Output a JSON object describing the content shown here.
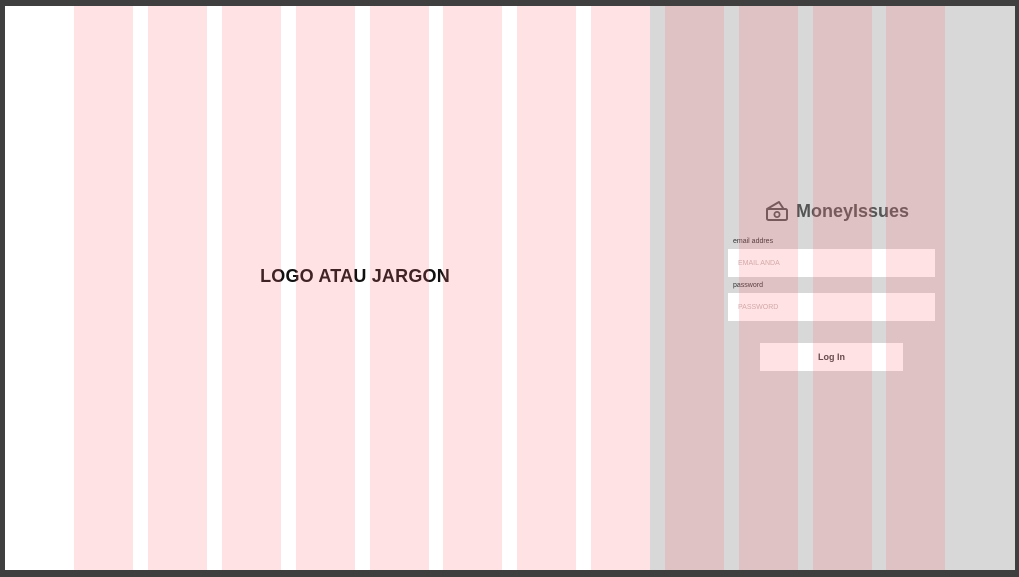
{
  "left_panel": {
    "tagline": "LOGO ATAU JARGON"
  },
  "brand": {
    "name": "MoneyIssues",
    "icon": "money-house-icon"
  },
  "form": {
    "email_label": "email addres",
    "email_placeholder": "EMAIL ANDA",
    "email_value": "",
    "password_label": "password",
    "password_placeholder": "PASSWORD",
    "password_value": "",
    "login_label": "Log In"
  },
  "colors": {
    "frame_border": "#3f3f3f",
    "right_panel": "#d8d8d8",
    "grid_overlay": "#ff7378",
    "tagline": "#111111",
    "brand_text": "#555555"
  }
}
